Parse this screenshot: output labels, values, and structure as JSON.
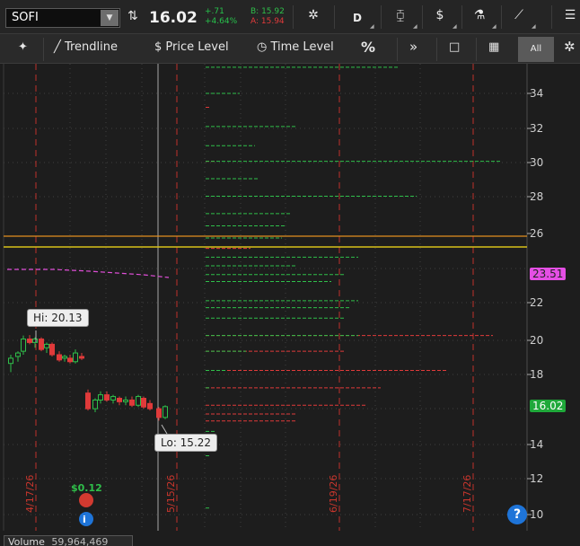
{
  "toolbar": {
    "symbol": "SOFI",
    "last_price": "16.02",
    "change": "+.71",
    "change_pct": "+4.64%",
    "bid": "B: 15.92",
    "ask": "A: 15.94",
    "aggregation": "D"
  },
  "drawing_tools": {
    "trendline": "Trendline",
    "price_level": "Price Level",
    "time_level": "Time Level",
    "percent": "%",
    "more": "»",
    "all": "All"
  },
  "chart": {
    "y_ticks": [
      "34",
      "32",
      "30",
      "28",
      "26",
      "22",
      "20",
      "18",
      "14",
      "12",
      "10"
    ],
    "x_dates": [
      "4/17/26",
      "5/15/26",
      "6/19/26",
      "7/17/26"
    ],
    "hi_label": "Hi: 20.13",
    "lo_label": "Lo: 15.22",
    "last_tag": "16.02",
    "ma_tag": "23.51",
    "dividend": "$0.12",
    "volume_label": "Volume",
    "volume_value": "59,964,469",
    "help": "?",
    "colors": {
      "up": "#2fbf4a",
      "down": "#e03a3a",
      "ma": "#e04ed8",
      "level_orange": "#e2901f",
      "level_yellow": "#d8c21a",
      "last_tag_bg": "#1fa83a",
      "ma_tag_bg": "#e54fe5"
    }
  }
}
